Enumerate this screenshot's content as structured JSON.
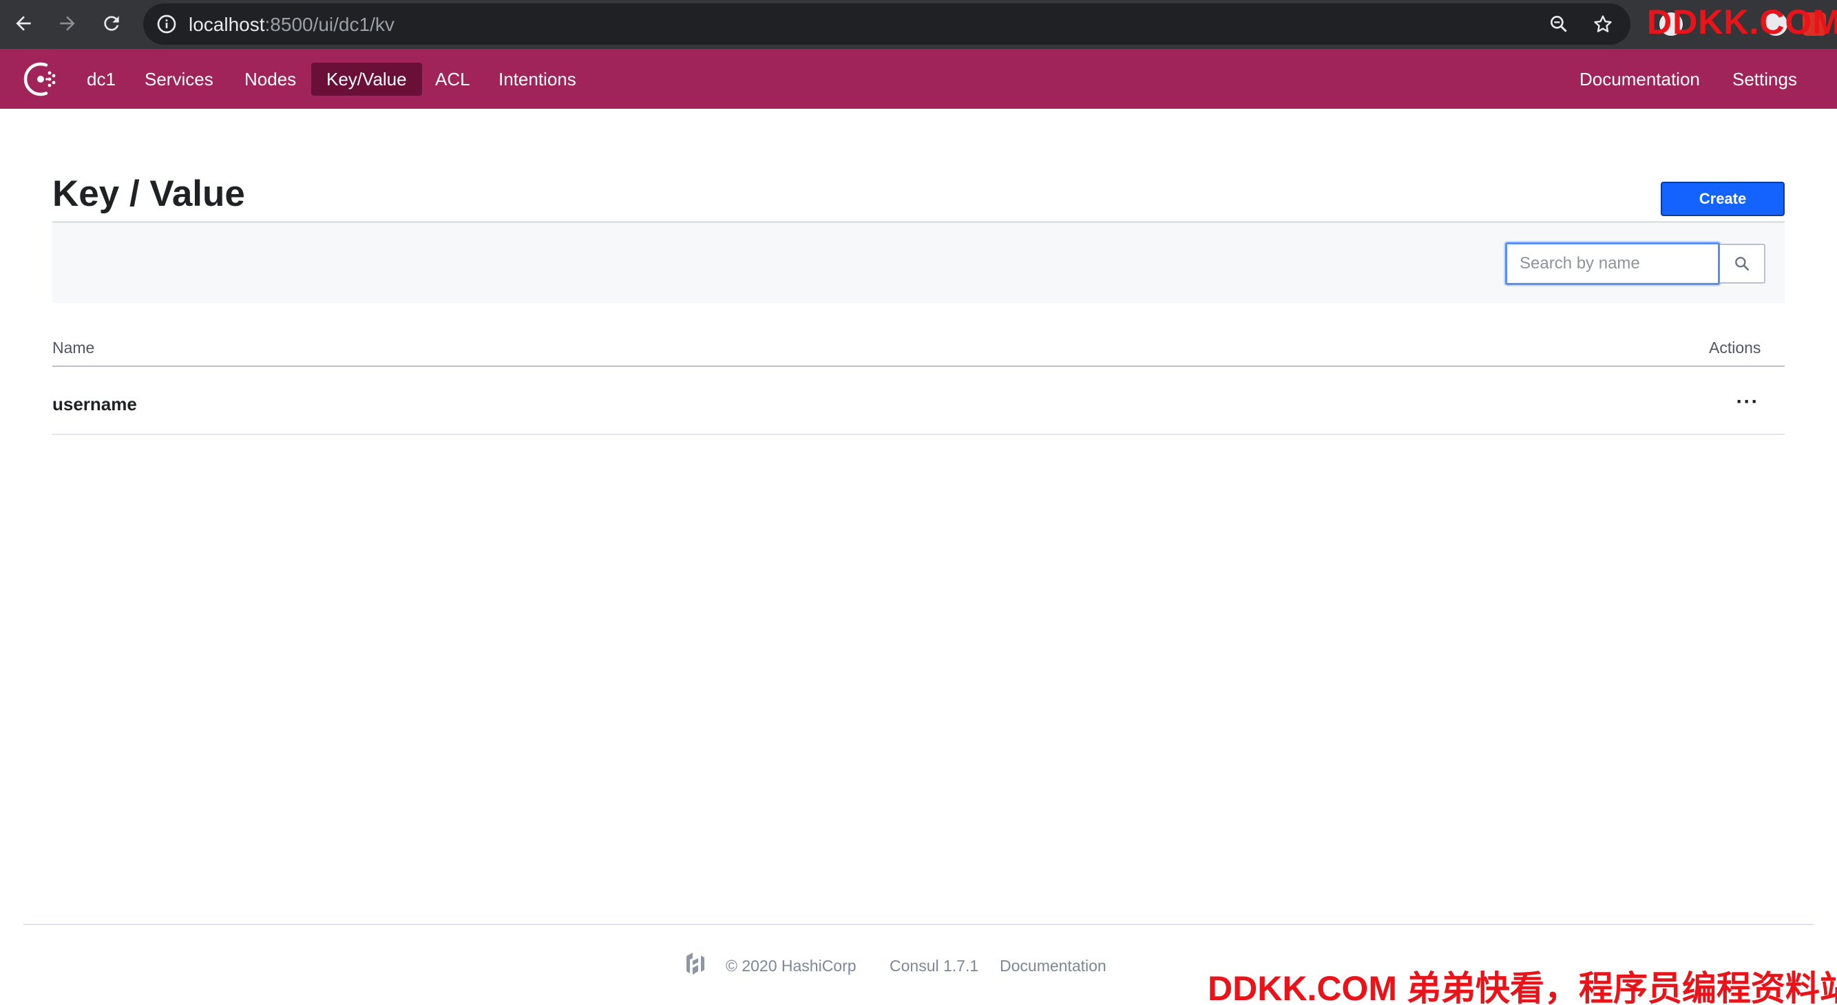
{
  "browser": {
    "url_host": "localhost",
    "url_path": ":8500/ui/dc1/kv"
  },
  "watermark": {
    "top": "DDKK.COM",
    "bottom": "DDKK.COM 弟弟快看，程序员编程资料站"
  },
  "header": {
    "datacenter": "dc1",
    "nav": [
      "Services",
      "Nodes",
      "Key/Value",
      "ACL",
      "Intentions"
    ],
    "active_nav": "Key/Value",
    "right_nav": [
      "Documentation",
      "Settings"
    ]
  },
  "page": {
    "title": "Key / Value",
    "create_label": "Create"
  },
  "search": {
    "placeholder": "Search by name",
    "value": ""
  },
  "table": {
    "columns": [
      "Name",
      "Actions"
    ],
    "rows": [
      {
        "name": "username",
        "actions": "···"
      }
    ]
  },
  "footer": {
    "copyright": "© 2020 HashiCorp",
    "version": "Consul 1.7.1",
    "docs": "Documentation"
  },
  "colors": {
    "brand": "#a0235a",
    "brand_active": "#6a1038",
    "primary_button": "#1563ff",
    "watermark": "#e8141a"
  }
}
